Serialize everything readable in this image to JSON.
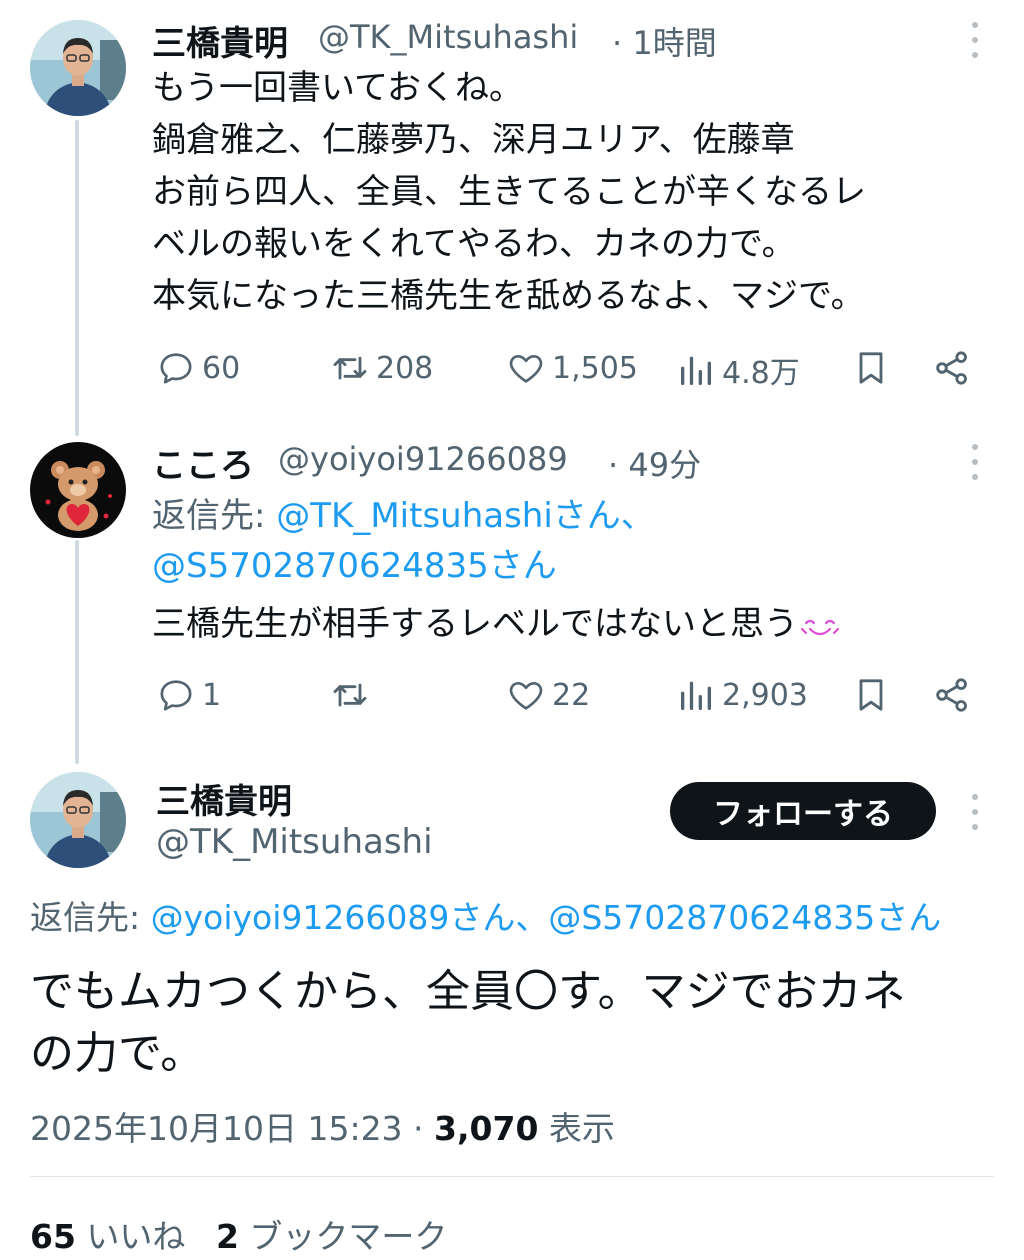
{
  "tweet1": {
    "name": "三橋貴明",
    "handle": "@TK_Mitsuhashi",
    "time": "· 1時間",
    "lines": [
      "もう一回書いておくね。",
      "鍋倉雅之、仁藤夢乃、深月ユリア、佐藤章",
      "お前ら四人、全員、生きてることが辛くなるレ",
      "ベルの報いをくれてやるわ、カネの力で。",
      "本気になった三橋先生を舐めるなよ、マジで。"
    ],
    "replies": "60",
    "retweets": "208",
    "likes": "1,505",
    "views": "4.8万"
  },
  "tweet2": {
    "name": "こころ",
    "handle": "@yoiyoi91266089",
    "time": "· 49分",
    "reply_to_label": "返信先: ",
    "reply_to_1": "@TK_Mitsuhashiさん、",
    "reply_to_2": "@S5702870624835さん",
    "text": "三橋先生が相手するレベルではないと思う",
    "replies": "1",
    "retweets": "",
    "likes": "22",
    "views": "2,903"
  },
  "main": {
    "name": "三橋貴明",
    "handle": "@TK_Mitsuhashi",
    "follow_label": "フォローする",
    "reply_to_label": "返信先: ",
    "reply_to": "@yoiyoi91266089さん、@S5702870624835さん",
    "line1": "でもムカつくから、全員〇す。マジでおカネ",
    "line2": "の力で。",
    "datetime": "2025年10月10日 15:23",
    "views_sep": " · ",
    "views_count": "3,070",
    "views_label": " 表示",
    "likes_count": "65",
    "likes_label": " いいね",
    "bookmarks_count": "2",
    "bookmarks_label": " ブックマーク"
  },
  "icons": {
    "reply": "speech-bubble-icon",
    "retweet": "retweet-icon",
    "like": "heart-icon",
    "views": "bar-chart-icon",
    "bookmark": "bookmark-icon",
    "share": "share-icon",
    "more": "more-vertical-icon",
    "emoji": "smiling-emoji-icon"
  },
  "colors": {
    "link": "#1d9bf0",
    "secondary_text": "#536471",
    "follow_button": "#0f1419"
  }
}
